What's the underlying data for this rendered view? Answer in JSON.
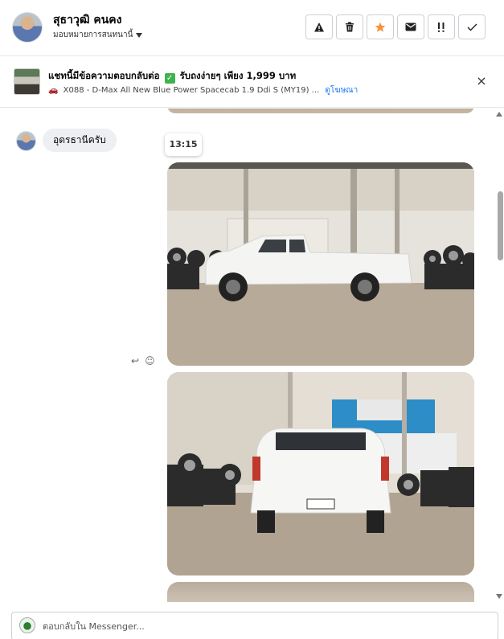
{
  "header": {
    "name": "สุธาวุฒิ คนคง",
    "assign_label": "มอบหมายการสนทนานี้",
    "actions": [
      "spam-icon",
      "delete-icon",
      "star-icon",
      "mark-unread-icon",
      "follow-up-icon",
      "done-icon"
    ],
    "star_color": "#f7923a"
  },
  "banner": {
    "title_before": "แชทนี้มีข้อความตอบกลับต่อ",
    "title_after": "รับถงง่ายๆ เพียง 1,999 บาท",
    "subtitle": "X088 - D-Max All New Blue Power Spacecab 1.9 Ddi S (MY19) ...",
    "link": "ดูโฆษณา",
    "close": "×"
  },
  "conversation": {
    "incoming_message": "อุดรธานีครับ",
    "timestamp": "13:15",
    "attachments": [
      "car-side-photo",
      "car-rear-photo",
      "third-photo"
    ]
  },
  "composer": {
    "placeholder": "ตอบกลับใน Messenger..."
  },
  "colors": {
    "accent": "#1877f2",
    "check": "#3fb34f",
    "bubble": "#eeeff2"
  }
}
